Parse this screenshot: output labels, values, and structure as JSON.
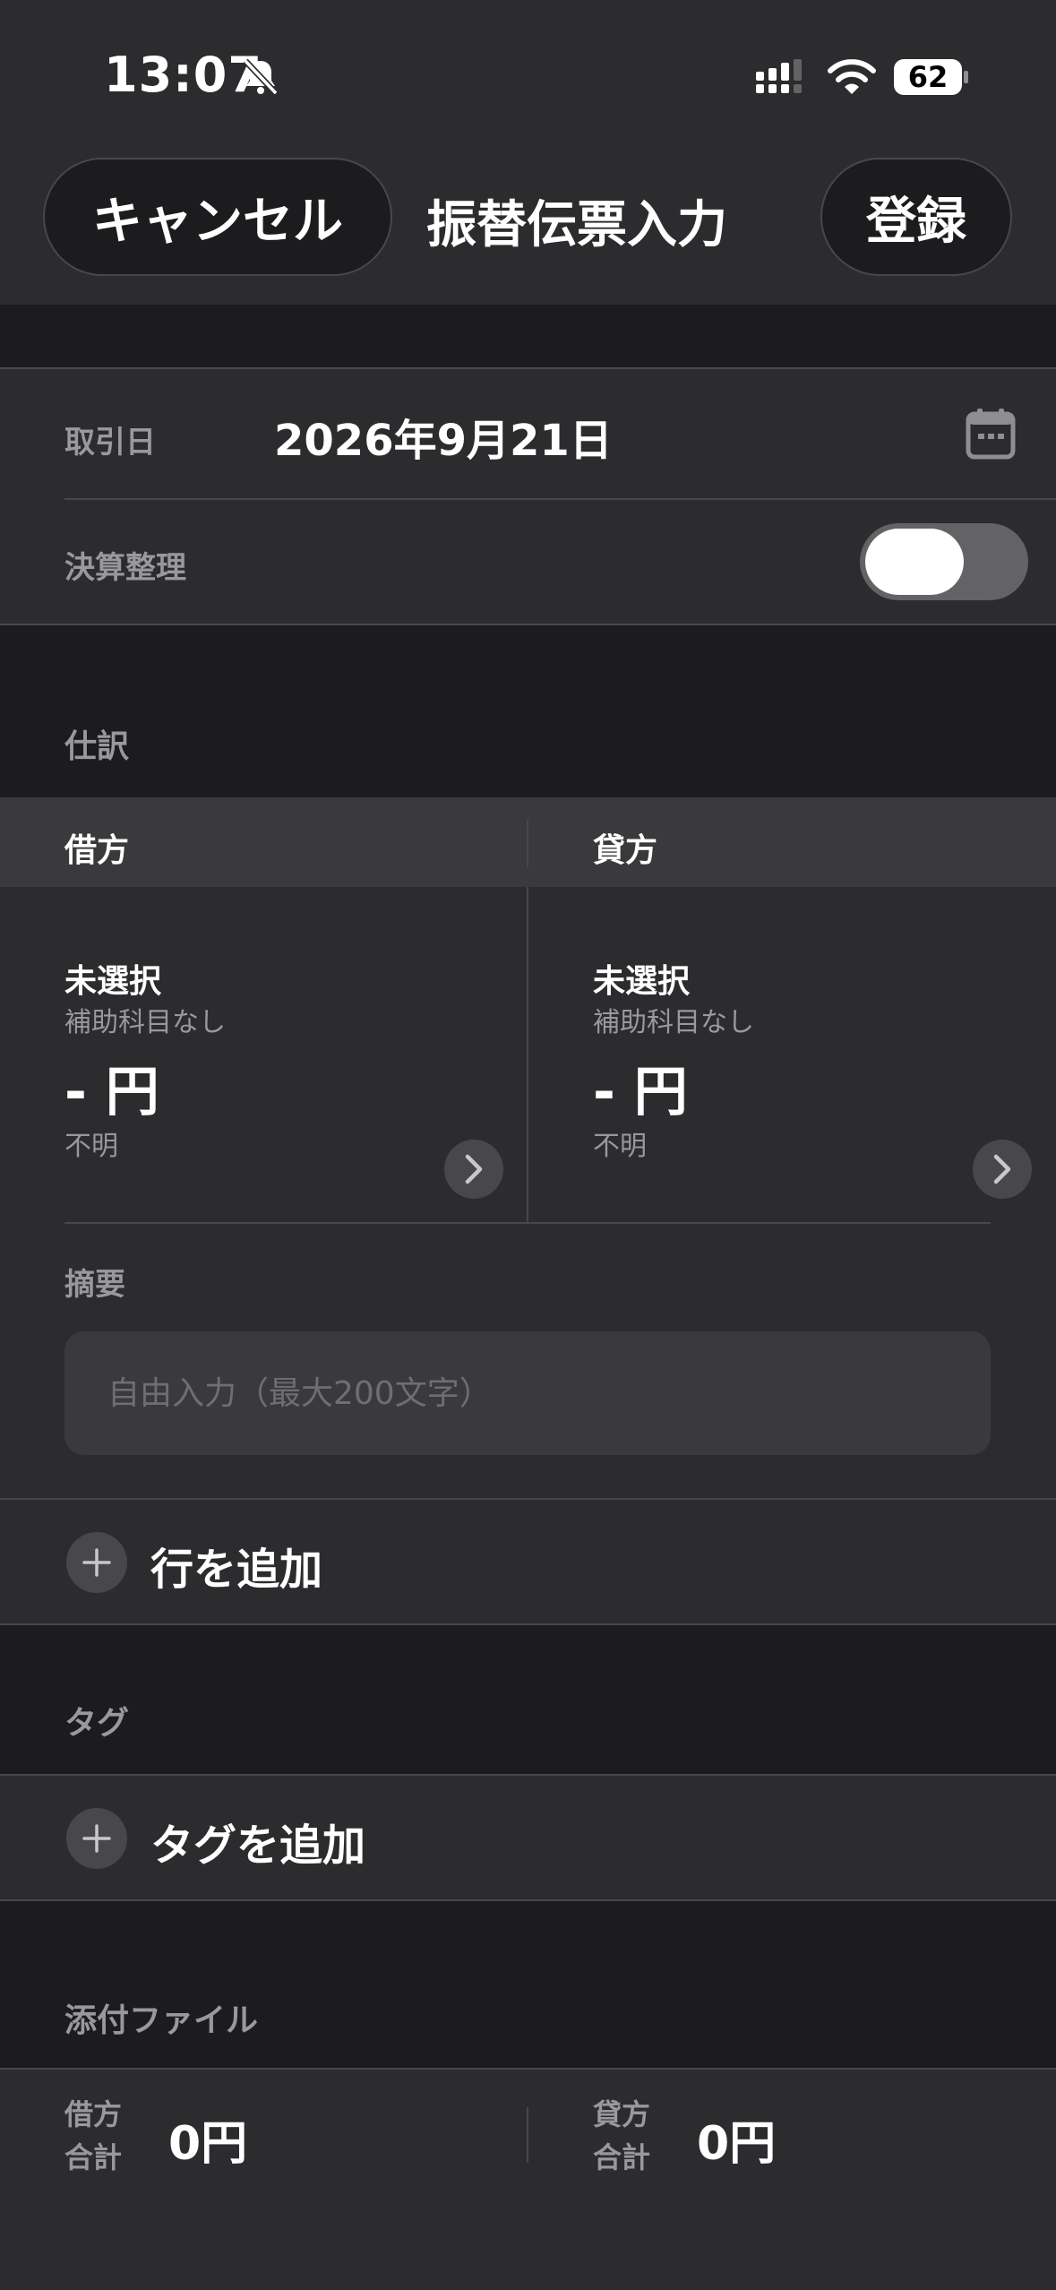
{
  "status_bar": {
    "time": "13:07",
    "battery": "62",
    "icons": [
      "bell-slash-icon",
      "cellular-signal-icon",
      "wifi-icon",
      "battery-icon"
    ]
  },
  "nav": {
    "cancel_label": "キャンセル",
    "title": "振替伝票入力",
    "save_label": "登録"
  },
  "form": {
    "date_label": "取引日",
    "date_value": "2026年9月21日",
    "date_icon": "calendar-icon",
    "closing_label": "決算整理",
    "closing_enabled": true
  },
  "journal": {
    "section_label": "仕訳",
    "debit": {
      "header": "借方",
      "account": "未選択",
      "sub_account": "補助科目なし",
      "amount": "- 円",
      "tax": "不明"
    },
    "credit": {
      "header": "貸方",
      "account": "未選択",
      "sub_account": "補助科目なし",
      "amount": "- 円",
      "tax": "不明"
    },
    "memo_label": "摘要",
    "memo_placeholder": "自由入力（最大200文字）",
    "add_row_label": "行を追加"
  },
  "tags": {
    "section_label": "タグ",
    "add_label": "タグを追加"
  },
  "attachments": {
    "section_label": "添付ファイル"
  },
  "totals": {
    "debit_label_1": "借方",
    "debit_label_2": "合計",
    "debit_amount": "0円",
    "credit_label_1": "貸方",
    "credit_label_2": "合計",
    "credit_amount": "0円"
  },
  "colors": {
    "background": "#1c1c1e",
    "surface": "#2c2c2e",
    "secondary_text": "#98989d",
    "separator": "#48484a",
    "toggle_track": "#636366"
  }
}
